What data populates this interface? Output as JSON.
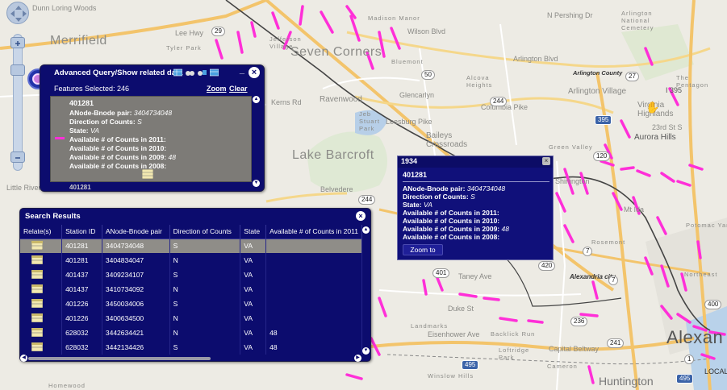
{
  "map": {
    "place_labels_big": [
      {
        "text": "Merrifield"
      },
      {
        "text": "Seven Corners"
      },
      {
        "text": "Lake Barcroft"
      },
      {
        "text": "Alexan"
      }
    ],
    "place_labels_med": [
      {
        "text": "Arlington Village"
      },
      {
        "text": "Virginia Highlands"
      },
      {
        "text": "Ravenwood"
      },
      {
        "text": "Glencarlyn"
      },
      {
        "text": "Baileys Crossroads"
      },
      {
        "text": "Belvedere"
      },
      {
        "text": "Huntington"
      },
      {
        "text": "Aurora Hills"
      },
      {
        "text": "Shirlington"
      },
      {
        "text": "Alexandria city"
      }
    ],
    "place_labels_sm": [
      {
        "text": "Dunn Loring Woods"
      },
      {
        "text": "Tyler Park"
      },
      {
        "text": "Jefferson Village"
      },
      {
        "text": "Madison Manor"
      },
      {
        "text": "Wilson Blvd"
      },
      {
        "text": "Arlington Blvd"
      },
      {
        "text": "Arlington County"
      },
      {
        "text": "Columbia Pike"
      },
      {
        "text": "Leesburg Pike"
      },
      {
        "text": "Little River"
      },
      {
        "text": "Kerns Rd"
      },
      {
        "text": "Bluemont"
      },
      {
        "text": "Alcova Heights"
      },
      {
        "text": "Green Valley"
      },
      {
        "text": "Landmarks"
      },
      {
        "text": "Eisenhower Ave"
      },
      {
        "text": "Backlick Run"
      },
      {
        "text": "Capital Beltway"
      },
      {
        "text": "Winslow Hills"
      },
      {
        "text": "Homewood"
      },
      {
        "text": "Rosemont"
      },
      {
        "text": "Northeast"
      },
      {
        "text": "Potomac Yard"
      },
      {
        "text": "Duke St"
      },
      {
        "text": "Taney Ave"
      },
      {
        "text": "Mt Ida"
      },
      {
        "text": "Arlington National Cemetery"
      },
      {
        "text": "The Pentagon"
      },
      {
        "text": "Cameron"
      },
      {
        "text": "Loftridge Park"
      },
      {
        "text": "Jeb Stuart Park"
      },
      {
        "text": "23rd St S"
      },
      {
        "text": "Lee Hwy"
      },
      {
        "text": "I 395"
      }
    ],
    "shields": [
      "29",
      "50",
      "244",
      "244",
      "120",
      "7",
      "7",
      "401",
      "420",
      "400",
      "236",
      "241",
      "1",
      "27",
      "495",
      "495",
      "395"
    ],
    "zoom_label": "N Pershing Dr",
    "local_label": "LOCAL"
  },
  "query_window": {
    "title": "Advanced Query/Show related data",
    "features_selected": "Features Selected: 246",
    "zoom_label": "Zoom",
    "clear_label": "Clear",
    "record": {
      "id": "401281",
      "lines": [
        {
          "label": "ANode-Bnode pair:",
          "value": "3404734048"
        },
        {
          "label": "Direction of Counts:",
          "value": "S"
        },
        {
          "label": "State:",
          "value": "VA"
        },
        {
          "label": "Available # of Counts in 2011:",
          "value": ""
        },
        {
          "label": "Available # of Counts in 2010:",
          "value": ""
        },
        {
          "label": "Available # of Counts in 2009:",
          "value": "48"
        },
        {
          "label": "Available # of Counts in 2008:",
          "value": ""
        }
      ]
    },
    "next_id": "401281",
    "minimize_label": "_"
  },
  "results": {
    "title": "Search Results",
    "columns": [
      "Relate(s)",
      "Station ID",
      "ANode-Bnode pair",
      "Direction of Counts",
      "State",
      "Available # of Counts in 2011"
    ],
    "rows": [
      {
        "station": "401281",
        "pair": "3404734048",
        "dir": "S",
        "state": "VA",
        "c2011": "",
        "selected": true
      },
      {
        "station": "401281",
        "pair": "3404834047",
        "dir": "N",
        "state": "VA",
        "c2011": "",
        "selected": false
      },
      {
        "station": "401437",
        "pair": "3409234107",
        "dir": "S",
        "state": "VA",
        "c2011": "",
        "selected": false
      },
      {
        "station": "401437",
        "pair": "3410734092",
        "dir": "N",
        "state": "VA",
        "c2011": "",
        "selected": false
      },
      {
        "station": "401226",
        "pair": "3450034006",
        "dir": "S",
        "state": "VA",
        "c2011": "",
        "selected": false
      },
      {
        "station": "401226",
        "pair": "3400634500",
        "dir": "N",
        "state": "VA",
        "c2011": "",
        "selected": false
      },
      {
        "station": "628032",
        "pair": "3442634421",
        "dir": "N",
        "state": "VA",
        "c2011": "48",
        "selected": false
      },
      {
        "station": "628032",
        "pair": "3442134426",
        "dir": "S",
        "state": "VA",
        "c2011": "48",
        "selected": false
      }
    ]
  },
  "popup": {
    "number": "1934",
    "id": "401281",
    "lines": [
      {
        "label": "ANode-Bnode pair:",
        "value": "3404734048"
      },
      {
        "label": "Direction of Counts:",
        "value": "S"
      },
      {
        "label": "State:",
        "value": "VA"
      },
      {
        "label": "Available # of Counts in 2011:",
        "value": ""
      },
      {
        "label": "Available # of Counts in 2010:",
        "value": ""
      },
      {
        "label": "Available # of Counts in 2009:",
        "value": "48"
      },
      {
        "label": "Available # of Counts in 2008:",
        "value": ""
      }
    ],
    "zoom_button": "Zoom to"
  },
  "colors": {
    "panel": "#0c0c6e",
    "highlight_segment": "#ff2fd8",
    "selected_row": "#8f8d88"
  }
}
